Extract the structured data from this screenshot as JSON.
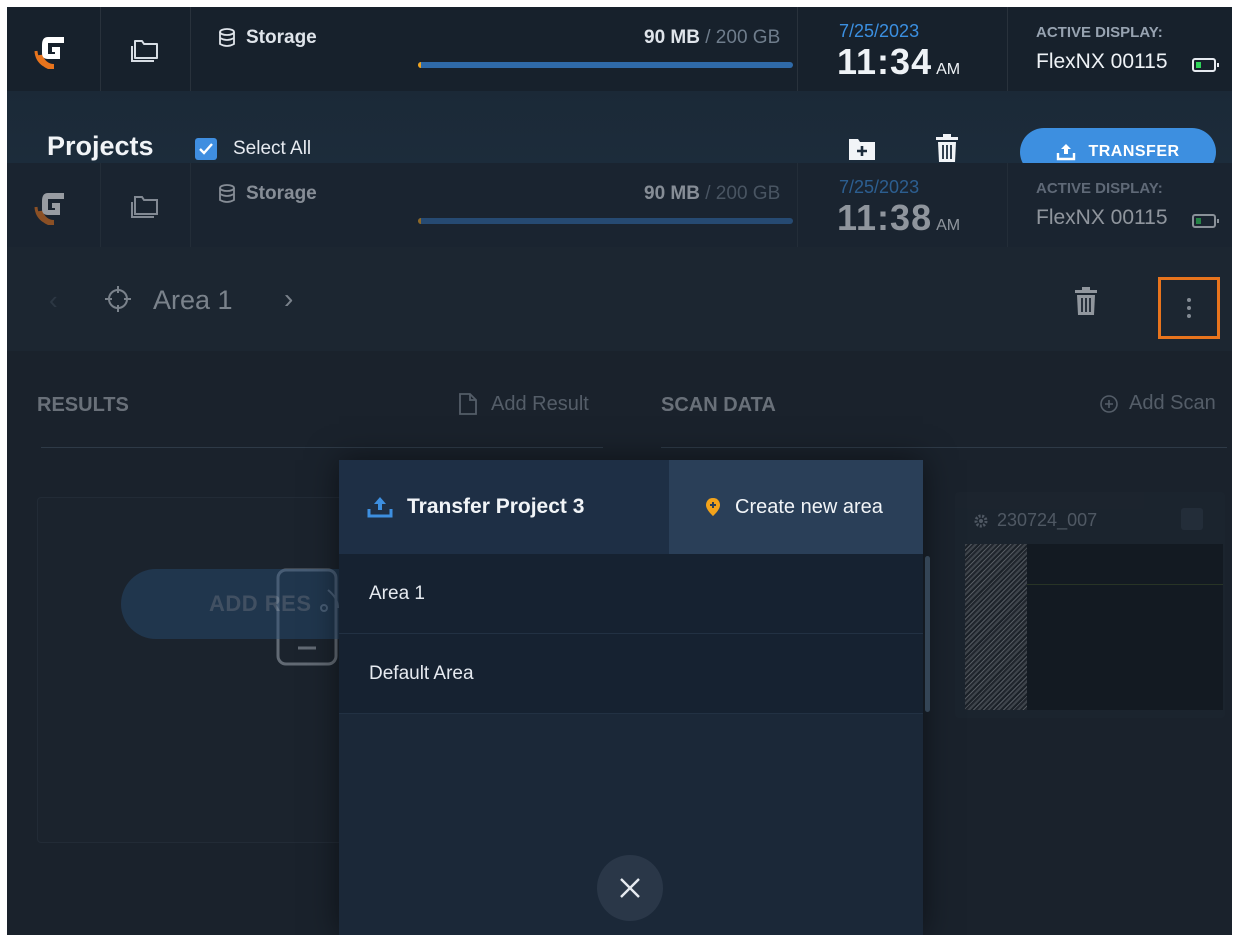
{
  "colors": {
    "accent_blue": "#3d8fe0",
    "storage_fill": "#f2a31b",
    "battery_green": "#2fd45a",
    "highlight_orange": "#e8741d",
    "location_pin": "#f2a31b"
  },
  "topbar": {
    "storage_label": "Storage",
    "storage_used": "90 MB",
    "storage_total": "/ 200 GB",
    "storage_fraction": 0.0004,
    "date": "7/25/2023",
    "time": "11:34",
    "ampm": "AM",
    "active_display_label": "ACTIVE DISPLAY:",
    "active_display_name": "FlexNX 00115"
  },
  "projects": {
    "title": "Projects",
    "select_all_label": "Select All",
    "select_all_checked": true,
    "transfer_label": "TRANSFER"
  },
  "underlay": {
    "topbar": {
      "storage_label": "Storage",
      "storage_used": "90 MB",
      "storage_total": "/ 200 GB",
      "date": "7/25/2023",
      "time": "11:38",
      "ampm": "AM",
      "active_display_label": "ACTIVE DISPLAY:",
      "active_display_name": "FlexNX 00115"
    },
    "area_title": "Area 1",
    "results_header": "RESULTS",
    "add_result_label": "Add Result",
    "scan_data_header": "SCAN DATA",
    "add_scan_label": "Add Scan",
    "add_result_button": "ADD RES",
    "scan_card_title": "230724_007"
  },
  "modal": {
    "transfer_title": "Transfer Project 3",
    "create_area_label": "Create new area",
    "areas": [
      "Area 1",
      "Default Area"
    ]
  }
}
